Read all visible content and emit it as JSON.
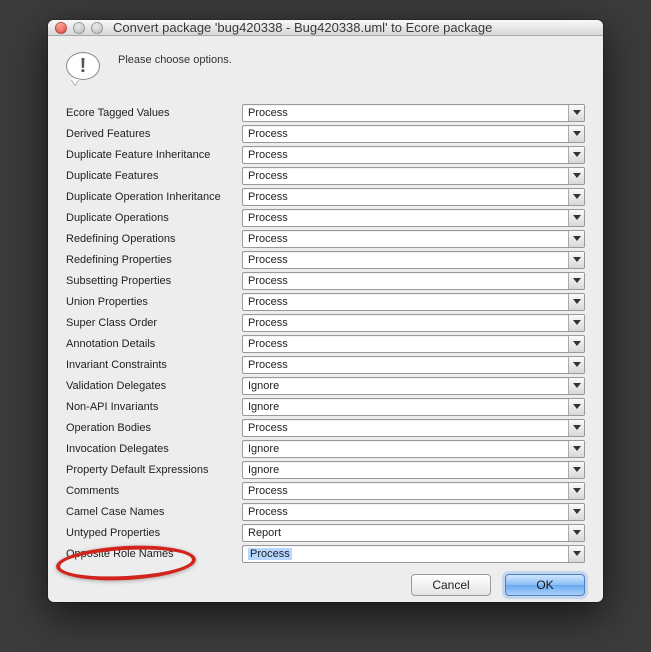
{
  "window": {
    "title": "Convert package 'bug420338 - Bug420338.uml' to Ecore package"
  },
  "header": {
    "prompt": "Please choose options."
  },
  "options": [
    {
      "label": "Ecore Tagged Values",
      "value": "Process",
      "selected": false
    },
    {
      "label": "Derived Features",
      "value": "Process",
      "selected": false
    },
    {
      "label": "Duplicate Feature Inheritance",
      "value": "Process",
      "selected": false
    },
    {
      "label": "Duplicate Features",
      "value": "Process",
      "selected": false
    },
    {
      "label": "Duplicate Operation Inheritance",
      "value": "Process",
      "selected": false
    },
    {
      "label": "Duplicate Operations",
      "value": "Process",
      "selected": false
    },
    {
      "label": "Redefining Operations",
      "value": "Process",
      "selected": false
    },
    {
      "label": "Redefining Properties",
      "value": "Process",
      "selected": false
    },
    {
      "label": "Subsetting Properties",
      "value": "Process",
      "selected": false
    },
    {
      "label": "Union Properties",
      "value": "Process",
      "selected": false
    },
    {
      "label": "Super Class Order",
      "value": "Process",
      "selected": false
    },
    {
      "label": "Annotation Details",
      "value": "Process",
      "selected": false
    },
    {
      "label": "Invariant Constraints",
      "value": "Process",
      "selected": false
    },
    {
      "label": "Validation Delegates",
      "value": "Ignore",
      "selected": false
    },
    {
      "label": "Non-API Invariants",
      "value": "Ignore",
      "selected": false
    },
    {
      "label": "Operation Bodies",
      "value": "Process",
      "selected": false
    },
    {
      "label": "Invocation Delegates",
      "value": "Ignore",
      "selected": false
    },
    {
      "label": "Property Default Expressions",
      "value": "Ignore",
      "selected": false
    },
    {
      "label": "Comments",
      "value": "Process",
      "selected": false
    },
    {
      "label": "Camel Case Names",
      "value": "Process",
      "selected": false
    },
    {
      "label": "Untyped Properties",
      "value": "Report",
      "selected": false
    },
    {
      "label": "Opposite Role Names",
      "value": "Process",
      "selected": true
    }
  ],
  "footer": {
    "cancel": "Cancel",
    "ok": "OK"
  },
  "annotation": {
    "highlighted_label": "Opposite Role Names"
  }
}
